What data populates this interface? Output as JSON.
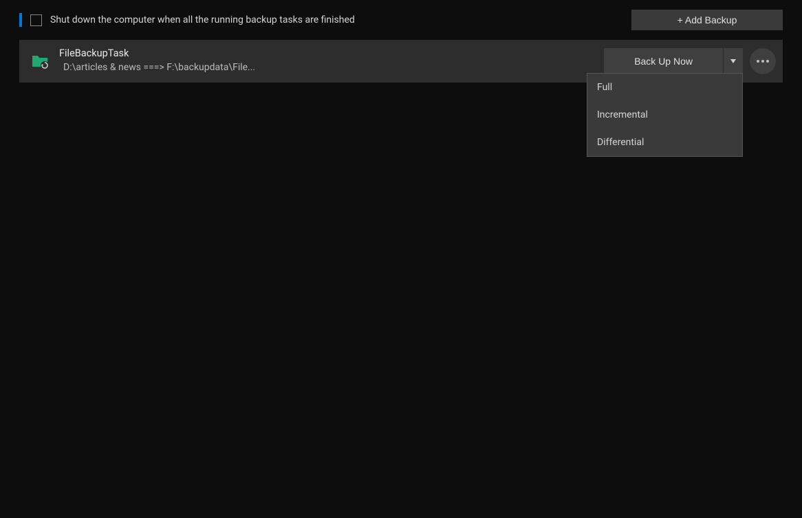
{
  "header": {
    "shutdown_label": "Shut down the computer when all the running backup tasks are finished",
    "add_backup_label": "+ Add Backup"
  },
  "task": {
    "title": "FileBackupTask",
    "path": "D:\\articles & news ===> F:\\backupdata\\File...",
    "backup_now_label": "Back Up Now"
  },
  "dropdown": {
    "items": [
      {
        "label": "Full"
      },
      {
        "label": "Incremental"
      },
      {
        "label": "Differential"
      }
    ]
  }
}
